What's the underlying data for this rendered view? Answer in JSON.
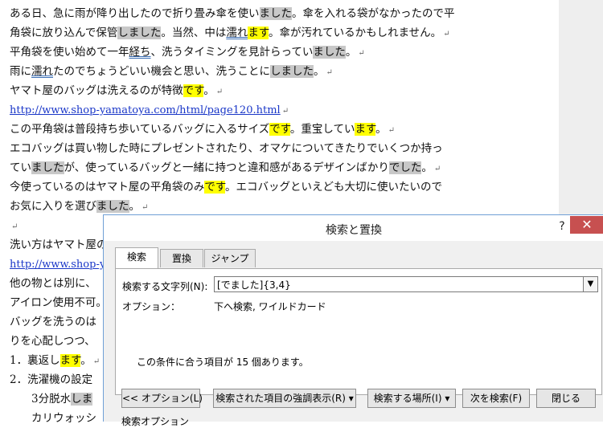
{
  "document": {
    "lines": [
      [
        {
          "t": "ある日、急に雨が降り出したので折り畳み傘を使い"
        },
        {
          "t": "ました",
          "h": "g"
        },
        {
          "t": "。傘を入れる袋がなかったので平"
        }
      ],
      [
        {
          "t": "角袋に放り込んで保管"
        },
        {
          "t": "しました",
          "h": "g"
        },
        {
          "t": "。当然、中は"
        },
        {
          "t": "濡れ",
          "h": "w"
        },
        {
          "t": "ます",
          "h": "y"
        },
        {
          "t": "。傘が汚れているかもしれません。"
        },
        {
          "t": "↵",
          "h": "p"
        }
      ],
      [
        {
          "t": "平角袋を使い始めて一年"
        },
        {
          "t": "経ち",
          "h": "w"
        },
        {
          "t": "、洗うタイミングを見計らってい"
        },
        {
          "t": "ました",
          "h": "g"
        },
        {
          "t": "。"
        },
        {
          "t": "↵",
          "h": "p"
        }
      ],
      [
        {
          "t": "雨に"
        },
        {
          "t": "濡れ",
          "h": "w"
        },
        {
          "t": "たのでちょうどいい機会と思い、洗うことに"
        },
        {
          "t": "しました",
          "h": "g"
        },
        {
          "t": "。"
        },
        {
          "t": "↵",
          "h": "p"
        }
      ],
      [
        {
          "t": "ヤマト屋のバッグは洗えるのが特徴"
        },
        {
          "t": "です",
          "h": "y"
        },
        {
          "t": "。"
        },
        {
          "t": "↵",
          "h": "p"
        }
      ],
      [
        {
          "t": "http://www.shop-yamatoya.com/html/page120.html",
          "h": "l"
        },
        {
          "t": "↵",
          "h": "p"
        }
      ],
      [
        {
          "t": "この平角袋は普段持ち歩いているバッグに入るサイズ"
        },
        {
          "t": "です",
          "h": "y"
        },
        {
          "t": "。重宝してい"
        },
        {
          "t": "ます",
          "h": "y"
        },
        {
          "t": "。"
        },
        {
          "t": "↵",
          "h": "p"
        }
      ],
      [
        {
          "t": "エコバッグは買い物した時にプレゼントされたり、オマケについてきたりでいくつか持っ"
        }
      ],
      [
        {
          "t": "てい"
        },
        {
          "t": "ました",
          "h": "g"
        },
        {
          "t": "が、使っているバッグと一緒に持つと違和感があるデザインばかり"
        },
        {
          "t": "でした",
          "h": "g"
        },
        {
          "t": "。"
        },
        {
          "t": "↵",
          "h": "p"
        }
      ],
      [
        {
          "t": "今使っているのはヤマト屋の平角袋のみ"
        },
        {
          "t": "です",
          "h": "y"
        },
        {
          "t": "。エコバッグといえども大切に使いたいので"
        }
      ],
      [
        {
          "t": "お気に入りを選び"
        },
        {
          "t": "ました",
          "h": "g"
        },
        {
          "t": "。"
        },
        {
          "t": "↵",
          "h": "p"
        }
      ],
      [
        {
          "t": "↵",
          "h": "p"
        }
      ],
      [
        {
          "t": "洗い方はヤマト屋の"
        }
      ],
      [
        {
          "t": "http://www.shop-y",
          "h": "l"
        }
      ],
      [
        {
          "t": "他の物とは別に、"
        }
      ],
      [
        {
          "t": "アイロン使用不可。"
        }
      ],
      [
        {
          "t": "バッグを洗うのは"
        }
      ],
      [
        {
          "t": "りを心配しつつ、"
        }
      ],
      [
        {
          "t": "1．裏返し"
        },
        {
          "t": "ます",
          "h": "y"
        },
        {
          "t": "。"
        },
        {
          "t": "↵",
          "h": "p"
        }
      ],
      [
        {
          "t": "2．洗濯機の設定"
        }
      ],
      [
        {
          "t": "　　3分脱水"
        },
        {
          "t": "しま",
          "h": "g"
        }
      ],
      [
        {
          "t": "　　カリウォッシ"
        }
      ]
    ]
  },
  "dialog": {
    "title": "検索と置換",
    "help": "?",
    "close": "✕",
    "tabs": [
      {
        "label": "検索",
        "active": true
      },
      {
        "label": "置換",
        "active": false
      },
      {
        "label": "ジャンプ",
        "active": false
      }
    ],
    "find_label": "検索する文字列(N):",
    "find_value": "[でました]{3,4}",
    "options_label": "オプション：",
    "options_value": "下へ検索, ワイルドカード",
    "result": "この条件に合う項目が 15 個あります。",
    "buttons": {
      "options": "<< オプション(L)",
      "highlight": "検索された項目の強調表示(R) ▾",
      "search_in": "検索する場所(I) ▾",
      "find_next": "次を検索(F)",
      "close": "閉じる"
    },
    "bottom_label": "検索オプション"
  }
}
